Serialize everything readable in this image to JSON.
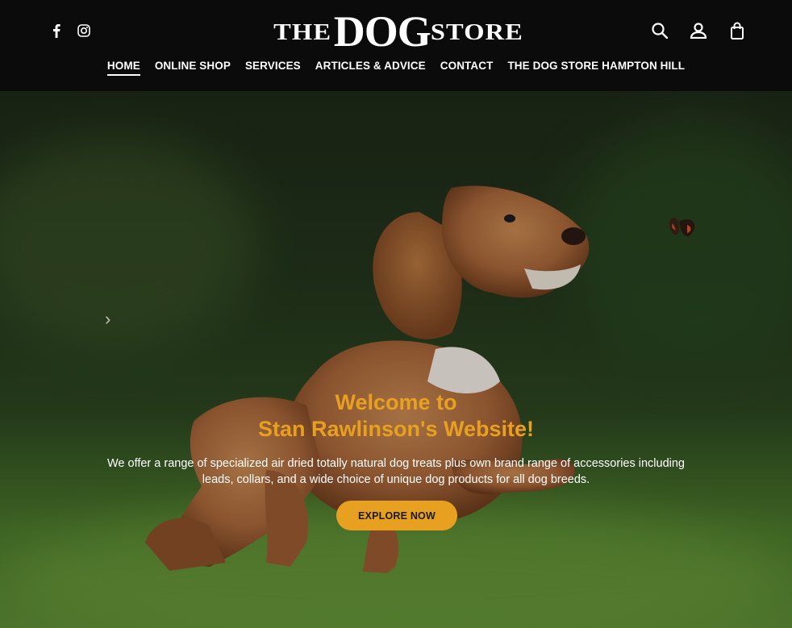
{
  "brand": {
    "logo_left": "THE",
    "logo_mid": "DOG",
    "logo_right": "STORE"
  },
  "social": [
    {
      "icon": "facebook-icon"
    },
    {
      "icon": "instagram-icon"
    }
  ],
  "tools": [
    {
      "icon": "search-icon"
    },
    {
      "icon": "account-icon"
    },
    {
      "icon": "shopping-bag-icon"
    }
  ],
  "nav": {
    "home": "HOME",
    "shop": "ONLINE SHOP",
    "services": "SERVICES",
    "articles": "ARTICLES & ADVICE",
    "contact": "CONTACT",
    "hampton": "THE DOG STORE HAMPTON HILL"
  },
  "hero": {
    "title_line1": "Welcome to",
    "title_line2": "Stan Rawlinson's Website!",
    "description": "We offer a range of specialized air dried totally natural dog treats plus own brand range of accessories including leads, collars, and a wide choice of unique dog products for all dog breeds.",
    "cta": "EXPLORE NOW"
  },
  "colors": {
    "header_bg": "#0b0b0b",
    "accent": "#e8a020",
    "text": "#ffffff"
  }
}
